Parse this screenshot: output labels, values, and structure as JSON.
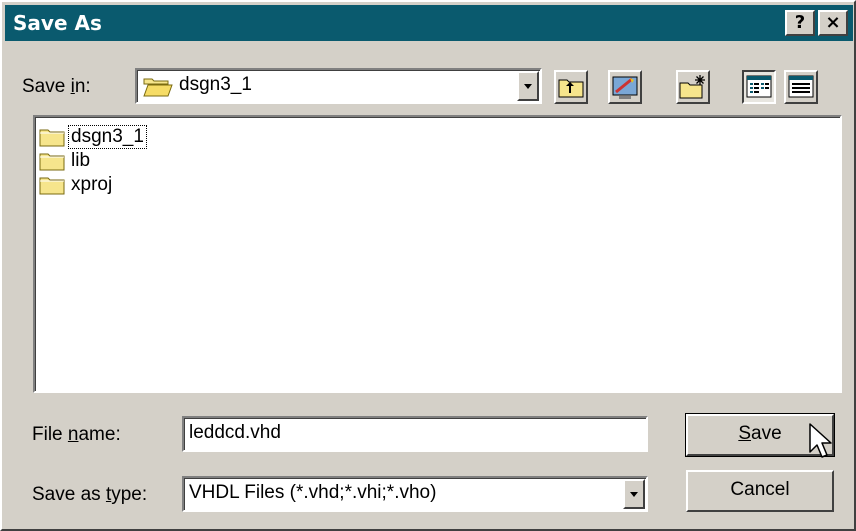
{
  "window": {
    "title": "Save As",
    "help_label": "?",
    "close_label": "×",
    "title_bar_color": "#0a5a6e"
  },
  "save_in": {
    "label_pre": "Save ",
    "label_key": "i",
    "label_post": "n:",
    "value": "dsgn3_1",
    "icon": "open-folder-icon"
  },
  "toolbar": {
    "up_folder": "up-folder-icon",
    "desktop": "desktop-icon",
    "new_folder": "new-folder-icon",
    "list_view": "list-view-icon",
    "details_view": "details-view-icon"
  },
  "files": [
    {
      "name": "dsgn3_1",
      "icon": "folder-icon",
      "focused": true
    },
    {
      "name": "lib",
      "icon": "folder-icon",
      "focused": false
    },
    {
      "name": "xproj",
      "icon": "folder-icon",
      "focused": false
    }
  ],
  "file_name": {
    "label_pre": "File ",
    "label_key": "n",
    "label_post": "ame:",
    "value": "leddcd.vhd"
  },
  "save_as_type": {
    "label_pre": "Save as ",
    "label_key": "t",
    "label_post": "ype:",
    "value": "VHDL Files (*.vhd;*.vhi;*.vho)"
  },
  "buttons": {
    "save_key": "S",
    "save_rest": "ave",
    "cancel": "Cancel"
  }
}
